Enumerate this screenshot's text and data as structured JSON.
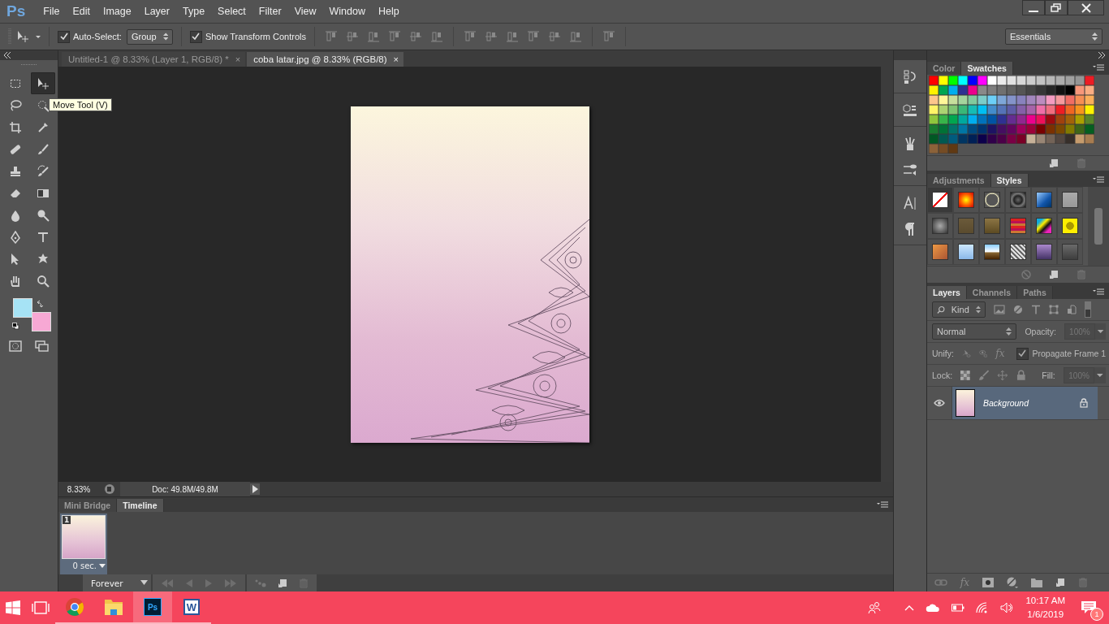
{
  "app": {
    "logo": "Ps"
  },
  "menu": [
    "File",
    "Edit",
    "Image",
    "Layer",
    "Type",
    "Select",
    "Filter",
    "View",
    "Window",
    "Help"
  ],
  "options_bar": {
    "auto_select": {
      "label": "Auto-Select:",
      "checked": true
    },
    "auto_select_target": "Group",
    "show_transform_controls": {
      "label": "Show Transform Controls",
      "checked": true
    },
    "workspace": "Essentials"
  },
  "tools": [
    {
      "kind": "marquee",
      "selected": false
    },
    {
      "kind": "move",
      "selected": true
    },
    {
      "kind": "lasso",
      "selected": false
    },
    {
      "kind": "quick_selection",
      "selected": false
    },
    {
      "kind": "crop",
      "selected": false
    },
    {
      "kind": "eyedropper",
      "selected": false
    },
    {
      "kind": "healing",
      "selected": false
    },
    {
      "kind": "brush",
      "selected": false
    },
    {
      "kind": "stamp",
      "selected": false
    },
    {
      "kind": "history_brush",
      "selected": false
    },
    {
      "kind": "eraser",
      "selected": false
    },
    {
      "kind": "gradient",
      "selected": false
    },
    {
      "kind": "blur",
      "selected": false
    },
    {
      "kind": "dodge",
      "selected": false
    },
    {
      "kind": "pen",
      "selected": false
    },
    {
      "kind": "type",
      "selected": false
    },
    {
      "kind": "path_selection",
      "selected": false
    },
    {
      "kind": "shape",
      "selected": false
    },
    {
      "kind": "hand",
      "selected": false
    },
    {
      "kind": "zoom",
      "selected": false
    }
  ],
  "colors": {
    "foreground": {
      "color": "#a6e3f5"
    },
    "background": {
      "color": "#f7a8d4"
    }
  },
  "tooltip": "Move Tool (V)",
  "document_tabs": [
    {
      "title": "Untitled-1 @ 8.33% (Layer 1, RGB/8) *",
      "close": "×",
      "selected": false
    },
    {
      "title": "coba latar.jpg @ 8.33% (RGB/8)",
      "close": "×",
      "selected": true
    }
  ],
  "status_bar": {
    "zoom": "8.33%",
    "doc_info": "Doc: 49.8M/49.8M"
  },
  "bottom_panel": {
    "tabs": [
      {
        "label": "Mini Bridge",
        "selected": false
      },
      {
        "label": "Timeline",
        "selected": true
      }
    ],
    "frames": [
      {
        "number": "1",
        "delay": "0 sec.",
        "selected": true
      }
    ],
    "loop": "Forever"
  },
  "swatches_panel": {
    "tabs": [
      {
        "label": "Color",
        "selected": false
      },
      {
        "label": "Swatches",
        "selected": true
      }
    ],
    "swatches": [
      {
        "color": "#ff0000"
      },
      {
        "color": "#ffff00"
      },
      {
        "color": "#00ff00"
      },
      {
        "color": "#00ffff"
      },
      {
        "color": "#0000ff"
      },
      {
        "color": "#ff00ff"
      },
      {
        "color": "#ffffff"
      },
      {
        "color": "#ebebeb"
      },
      {
        "color": "#e1e1e1"
      },
      {
        "color": "#d7d7d7"
      },
      {
        "color": "#cccccc"
      },
      {
        "color": "#c2c2c2"
      },
      {
        "color": "#b7b7b7"
      },
      {
        "color": "#acacac"
      },
      {
        "color": "#a0a0a0"
      },
      {
        "color": "#959595"
      },
      {
        "color": "#ed1c24"
      },
      {
        "color": "#fff200"
      },
      {
        "color": "#00a651"
      },
      {
        "color": "#00aeef"
      },
      {
        "color": "#2e3192"
      },
      {
        "color": "#ec008c"
      },
      {
        "color": "#898989"
      },
      {
        "color": "#7d7d7d"
      },
      {
        "color": "#707070"
      },
      {
        "color": "#636363"
      },
      {
        "color": "#555555"
      },
      {
        "color": "#464646"
      },
      {
        "color": "#363636"
      },
      {
        "color": "#262626"
      },
      {
        "color": "#111111"
      },
      {
        "color": "#000000"
      },
      {
        "color": "#f7977a"
      },
      {
        "color": "#fbad82"
      },
      {
        "color": "#fdc68c"
      },
      {
        "color": "#fff799"
      },
      {
        "color": "#c6df9c"
      },
      {
        "color": "#a4d49d"
      },
      {
        "color": "#81ca9d"
      },
      {
        "color": "#7bcdc9"
      },
      {
        "color": "#6ccff7"
      },
      {
        "color": "#7ea7d8"
      },
      {
        "color": "#8493ca"
      },
      {
        "color": "#8882be"
      },
      {
        "color": "#a286bd"
      },
      {
        "color": "#bc8cbf"
      },
      {
        "color": "#f49bc1"
      },
      {
        "color": "#f5999d"
      },
      {
        "color": "#f16d64"
      },
      {
        "color": "#f68e54"
      },
      {
        "color": "#fbaf5a"
      },
      {
        "color": "#fff467"
      },
      {
        "color": "#acd372"
      },
      {
        "color": "#7dc473"
      },
      {
        "color": "#39b778"
      },
      {
        "color": "#16bcb4"
      },
      {
        "color": "#00bff3"
      },
      {
        "color": "#438ccb"
      },
      {
        "color": "#5573b7"
      },
      {
        "color": "#5e5ca7"
      },
      {
        "color": "#855fa8"
      },
      {
        "color": "#a763a9"
      },
      {
        "color": "#ef6ea8"
      },
      {
        "color": "#f16d7e"
      },
      {
        "color": "#ee1d24"
      },
      {
        "color": "#f16522"
      },
      {
        "color": "#f7941d"
      },
      {
        "color": "#fff200"
      },
      {
        "color": "#8fc63d"
      },
      {
        "color": "#37b44a"
      },
      {
        "color": "#00a650"
      },
      {
        "color": "#00a99e"
      },
      {
        "color": "#00aeef"
      },
      {
        "color": "#0072bc"
      },
      {
        "color": "#0054a5"
      },
      {
        "color": "#2f3192"
      },
      {
        "color": "#652c91"
      },
      {
        "color": "#91278f"
      },
      {
        "color": "#ed008c"
      },
      {
        "color": "#ee105a"
      },
      {
        "color": "#9d0a0f"
      },
      {
        "color": "#a1410d"
      },
      {
        "color": "#a36209"
      },
      {
        "color": "#aba000"
      },
      {
        "color": "#588528"
      },
      {
        "color": "#197b30"
      },
      {
        "color": "#007236"
      },
      {
        "color": "#00736a"
      },
      {
        "color": "#0076a4"
      },
      {
        "color": "#004a80"
      },
      {
        "color": "#003370"
      },
      {
        "color": "#1d1363"
      },
      {
        "color": "#450e61"
      },
      {
        "color": "#62055f"
      },
      {
        "color": "#9e005c"
      },
      {
        "color": "#9d0039"
      },
      {
        "color": "#790000"
      },
      {
        "color": "#7b3000"
      },
      {
        "color": "#7c4900"
      },
      {
        "color": "#827a00"
      },
      {
        "color": "#3e6617"
      },
      {
        "color": "#045f20"
      },
      {
        "color": "#005824"
      },
      {
        "color": "#005951"
      },
      {
        "color": "#005b7e"
      },
      {
        "color": "#003562"
      },
      {
        "color": "#002056"
      },
      {
        "color": "#0c004b"
      },
      {
        "color": "#30004a"
      },
      {
        "color": "#4b0048"
      },
      {
        "color": "#7a0045"
      },
      {
        "color": "#7a0026"
      },
      {
        "color": "#c7b299"
      },
      {
        "color": "#998675"
      },
      {
        "color": "#736357"
      },
      {
        "color": "#534741"
      },
      {
        "color": "#372f2a"
      },
      {
        "color": "#c69c6d"
      },
      {
        "color": "#a77c50"
      },
      {
        "color": "#8c6239"
      },
      {
        "color": "#754c24"
      },
      {
        "color": "#603913"
      }
    ]
  },
  "styles_panel": {
    "tabs": [
      {
        "label": "Adjustments",
        "selected": false
      },
      {
        "label": "Styles",
        "selected": true
      }
    ]
  },
  "layers_panel": {
    "tabs": [
      {
        "label": "Layers",
        "selected": true
      },
      {
        "label": "Channels",
        "selected": false
      },
      {
        "label": "Paths",
        "selected": false
      }
    ],
    "filter": "Kind",
    "blend_mode": "Normal",
    "opacity": {
      "label": "Opacity:",
      "value": "100%",
      "disabled": true
    },
    "unify": {
      "label": "Unify:",
      "fx": "fx"
    },
    "propagate": {
      "label": "Propagate Frame 1",
      "checked": true
    },
    "lock": {
      "label": "Lock:"
    },
    "fill": {
      "label": "Fill:",
      "value": "100%",
      "disabled": true
    },
    "layers": [
      {
        "name": "Background",
        "visible": true,
        "locked": true,
        "selected": true
      }
    ],
    "footer_fx": "fx"
  },
  "taskbar": {
    "apps": [
      {
        "kind": "chrome",
        "running": true,
        "active": false
      },
      {
        "kind": "explorer",
        "running": true,
        "active": false
      },
      {
        "kind": "photoshop",
        "glyph": "Ps",
        "running": true,
        "active": true
      },
      {
        "kind": "word",
        "glyph": "W",
        "running": true,
        "active": false
      }
    ],
    "time": "10:17 AM",
    "date": "1/6/2019",
    "notifications": "1"
  }
}
